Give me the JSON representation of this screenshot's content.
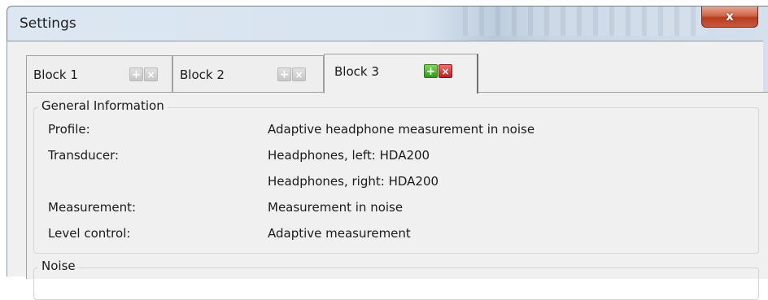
{
  "window": {
    "title": "Settings",
    "close_label": "x"
  },
  "tabs": [
    {
      "label": "Block 1",
      "add_enabled": false,
      "remove_enabled": false,
      "selected": false
    },
    {
      "label": "Block 2",
      "add_enabled": false,
      "remove_enabled": false,
      "selected": false
    },
    {
      "label": "Block 3",
      "add_enabled": true,
      "remove_enabled": true,
      "selected": true
    }
  ],
  "general": {
    "title": "General Information",
    "rows": [
      {
        "label": "Profile:",
        "value": "Adaptive headphone measurement in noise"
      },
      {
        "label": "Transducer:",
        "value": "Headphones, left: HDA200"
      },
      {
        "label": "",
        "value": "Headphones, right: HDA200"
      },
      {
        "label": "Measurement:",
        "value": "Measurement in noise"
      },
      {
        "label": "Level control:",
        "value": "Adaptive measurement"
      }
    ]
  },
  "noise": {
    "title": "Noise"
  },
  "icons": {
    "add": "plus-icon",
    "remove": "x-icon"
  },
  "colors": {
    "add_active": "#2f9a18",
    "remove_active": "#c21d1d",
    "close_button": "#c9593f"
  }
}
